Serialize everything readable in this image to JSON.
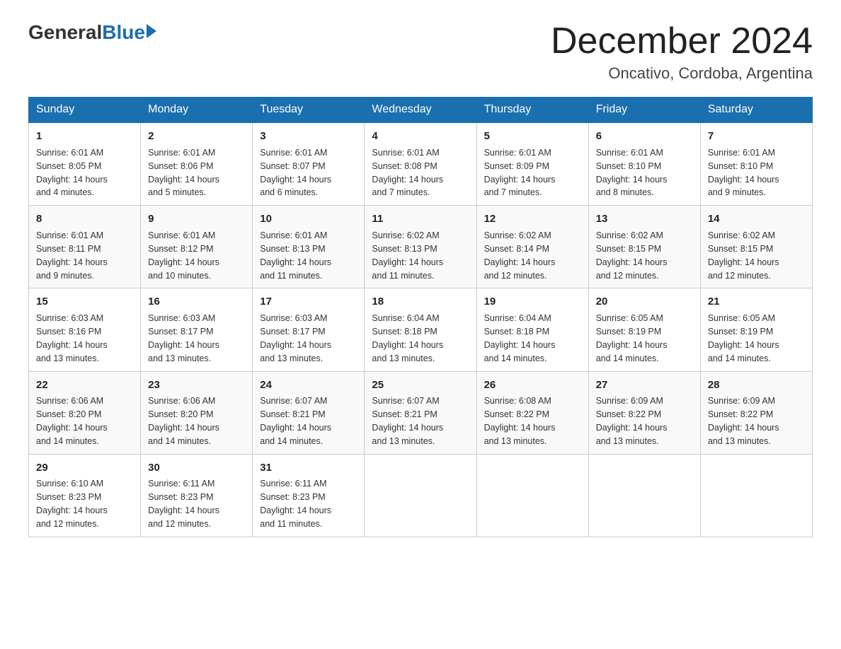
{
  "logo": {
    "general": "General",
    "blue": "Blue"
  },
  "title": "December 2024",
  "location": "Oncativo, Cordoba, Argentina",
  "days_of_week": [
    "Sunday",
    "Monday",
    "Tuesday",
    "Wednesday",
    "Thursday",
    "Friday",
    "Saturday"
  ],
  "weeks": [
    [
      {
        "day": "1",
        "sunrise": "6:01 AM",
        "sunset": "8:05 PM",
        "daylight": "14 hours and 4 minutes."
      },
      {
        "day": "2",
        "sunrise": "6:01 AM",
        "sunset": "8:06 PM",
        "daylight": "14 hours and 5 minutes."
      },
      {
        "day": "3",
        "sunrise": "6:01 AM",
        "sunset": "8:07 PM",
        "daylight": "14 hours and 6 minutes."
      },
      {
        "day": "4",
        "sunrise": "6:01 AM",
        "sunset": "8:08 PM",
        "daylight": "14 hours and 7 minutes."
      },
      {
        "day": "5",
        "sunrise": "6:01 AM",
        "sunset": "8:09 PM",
        "daylight": "14 hours and 7 minutes."
      },
      {
        "day": "6",
        "sunrise": "6:01 AM",
        "sunset": "8:10 PM",
        "daylight": "14 hours and 8 minutes."
      },
      {
        "day": "7",
        "sunrise": "6:01 AM",
        "sunset": "8:10 PM",
        "daylight": "14 hours and 9 minutes."
      }
    ],
    [
      {
        "day": "8",
        "sunrise": "6:01 AM",
        "sunset": "8:11 PM",
        "daylight": "14 hours and 9 minutes."
      },
      {
        "day": "9",
        "sunrise": "6:01 AM",
        "sunset": "8:12 PM",
        "daylight": "14 hours and 10 minutes."
      },
      {
        "day": "10",
        "sunrise": "6:01 AM",
        "sunset": "8:13 PM",
        "daylight": "14 hours and 11 minutes."
      },
      {
        "day": "11",
        "sunrise": "6:02 AM",
        "sunset": "8:13 PM",
        "daylight": "14 hours and 11 minutes."
      },
      {
        "day": "12",
        "sunrise": "6:02 AM",
        "sunset": "8:14 PM",
        "daylight": "14 hours and 12 minutes."
      },
      {
        "day": "13",
        "sunrise": "6:02 AM",
        "sunset": "8:15 PM",
        "daylight": "14 hours and 12 minutes."
      },
      {
        "day": "14",
        "sunrise": "6:02 AM",
        "sunset": "8:15 PM",
        "daylight": "14 hours and 12 minutes."
      }
    ],
    [
      {
        "day": "15",
        "sunrise": "6:03 AM",
        "sunset": "8:16 PM",
        "daylight": "14 hours and 13 minutes."
      },
      {
        "day": "16",
        "sunrise": "6:03 AM",
        "sunset": "8:17 PM",
        "daylight": "14 hours and 13 minutes."
      },
      {
        "day": "17",
        "sunrise": "6:03 AM",
        "sunset": "8:17 PM",
        "daylight": "14 hours and 13 minutes."
      },
      {
        "day": "18",
        "sunrise": "6:04 AM",
        "sunset": "8:18 PM",
        "daylight": "14 hours and 13 minutes."
      },
      {
        "day": "19",
        "sunrise": "6:04 AM",
        "sunset": "8:18 PM",
        "daylight": "14 hours and 14 minutes."
      },
      {
        "day": "20",
        "sunrise": "6:05 AM",
        "sunset": "8:19 PM",
        "daylight": "14 hours and 14 minutes."
      },
      {
        "day": "21",
        "sunrise": "6:05 AM",
        "sunset": "8:19 PM",
        "daylight": "14 hours and 14 minutes."
      }
    ],
    [
      {
        "day": "22",
        "sunrise": "6:06 AM",
        "sunset": "8:20 PM",
        "daylight": "14 hours and 14 minutes."
      },
      {
        "day": "23",
        "sunrise": "6:06 AM",
        "sunset": "8:20 PM",
        "daylight": "14 hours and 14 minutes."
      },
      {
        "day": "24",
        "sunrise": "6:07 AM",
        "sunset": "8:21 PM",
        "daylight": "14 hours and 14 minutes."
      },
      {
        "day": "25",
        "sunrise": "6:07 AM",
        "sunset": "8:21 PM",
        "daylight": "14 hours and 13 minutes."
      },
      {
        "day": "26",
        "sunrise": "6:08 AM",
        "sunset": "8:22 PM",
        "daylight": "14 hours and 13 minutes."
      },
      {
        "day": "27",
        "sunrise": "6:09 AM",
        "sunset": "8:22 PM",
        "daylight": "14 hours and 13 minutes."
      },
      {
        "day": "28",
        "sunrise": "6:09 AM",
        "sunset": "8:22 PM",
        "daylight": "14 hours and 13 minutes."
      }
    ],
    [
      {
        "day": "29",
        "sunrise": "6:10 AM",
        "sunset": "8:23 PM",
        "daylight": "14 hours and 12 minutes."
      },
      {
        "day": "30",
        "sunrise": "6:11 AM",
        "sunset": "8:23 PM",
        "daylight": "14 hours and 12 minutes."
      },
      {
        "day": "31",
        "sunrise": "6:11 AM",
        "sunset": "8:23 PM",
        "daylight": "14 hours and 11 minutes."
      },
      null,
      null,
      null,
      null
    ]
  ],
  "labels": {
    "sunrise": "Sunrise:",
    "sunset": "Sunset:",
    "daylight": "Daylight:"
  }
}
